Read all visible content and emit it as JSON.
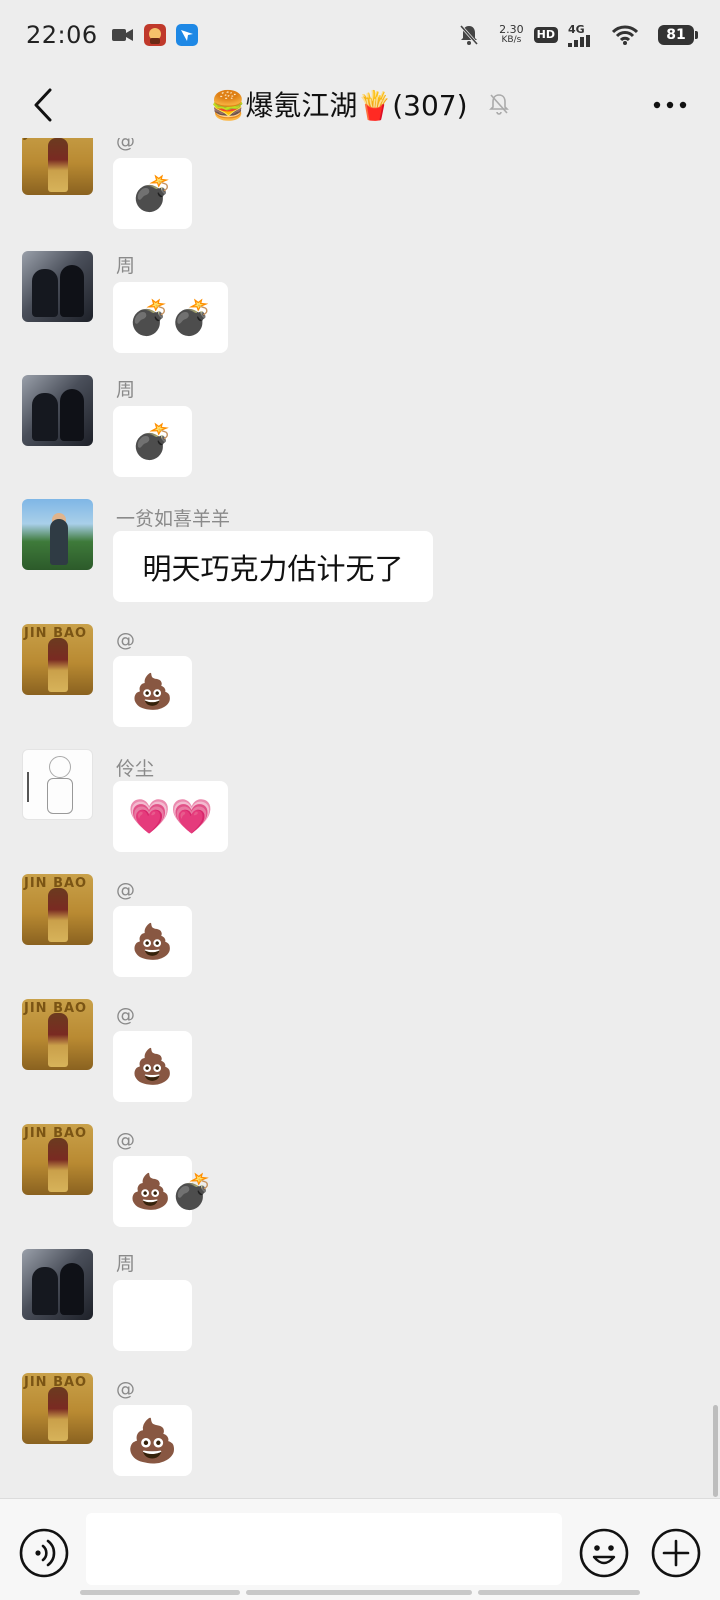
{
  "status_bar": {
    "time": "22:06",
    "net_speed_value": "2.30",
    "net_speed_unit": "KB/s",
    "hd": "HD",
    "network": "4G",
    "battery": "81"
  },
  "header": {
    "title": "🍔爆氪江湖🍟(307)",
    "back_icon": "chevron-left-icon",
    "mute_icon": "bell-off-icon",
    "more_icon": "ellipsis-icon"
  },
  "messages": [
    {
      "sender": "@",
      "content": "💣",
      "avatar": "gold-figure"
    },
    {
      "sender": "周",
      "content": "💣💣",
      "avatar": "cats"
    },
    {
      "sender": "周",
      "content": "💣",
      "avatar": "cats"
    },
    {
      "sender": "一贫如喜羊羊",
      "content": "明天巧克力估计无了",
      "avatar": "beach-person"
    },
    {
      "sender": "@",
      "content": "💩",
      "avatar": "gold-figure"
    },
    {
      "sender": "伶尘",
      "content": "💗💗",
      "avatar": "sketch-girl"
    },
    {
      "sender": "@",
      "content": "💩",
      "avatar": "gold-figure"
    },
    {
      "sender": "@",
      "content": "💩",
      "avatar": "gold-figure"
    },
    {
      "sender": "@",
      "content": "💩💣",
      "avatar": "gold-figure"
    },
    {
      "sender": "周",
      "content": "",
      "avatar": "cats"
    },
    {
      "sender": "@",
      "content": "💩",
      "avatar": "gold-figure"
    }
  ],
  "input_bar": {
    "voice_icon": "voice-icon",
    "input_value": "",
    "emoji_icon": "smile-icon",
    "plus_icon": "plus-circle-icon"
  }
}
